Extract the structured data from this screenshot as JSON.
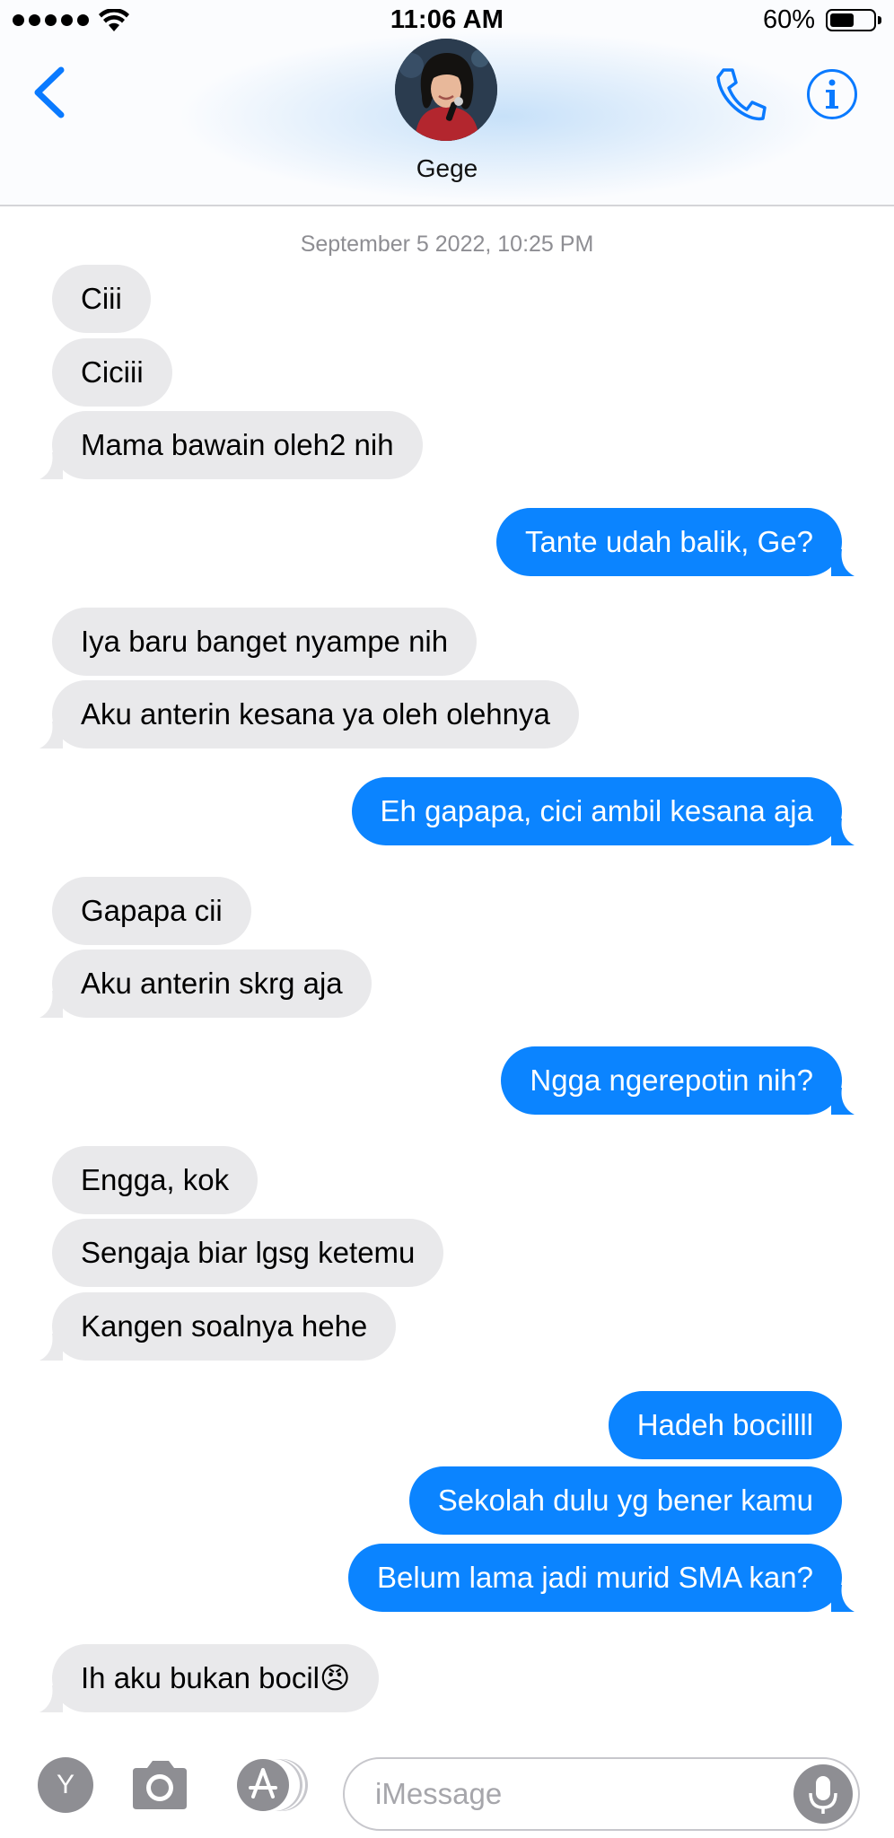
{
  "status_bar": {
    "time": "11:06 AM",
    "battery_percent": "60%",
    "battery_level": 0.6
  },
  "contact": {
    "name": "Gege"
  },
  "conversation": {
    "timestamp": "September 5 2022, 10:25 PM",
    "messages": [
      {
        "from": "them",
        "text": "Ciii"
      },
      {
        "from": "them",
        "text": "Ciciii"
      },
      {
        "from": "them",
        "text": "Mama bawain oleh2 nih"
      },
      {
        "from": "me",
        "text": "Tante udah balik, Ge?"
      },
      {
        "from": "them",
        "text": "Iya baru banget nyampe nih"
      },
      {
        "from": "them",
        "text": "Aku anterin kesana ya oleh olehnya"
      },
      {
        "from": "me",
        "text": "Eh gapapa, cici ambil kesana aja"
      },
      {
        "from": "them",
        "text": "Gapapa cii"
      },
      {
        "from": "them",
        "text": "Aku anterin skrg aja"
      },
      {
        "from": "me",
        "text": "Ngga ngerepotin nih?"
      },
      {
        "from": "them",
        "text": "Engga, kok"
      },
      {
        "from": "them",
        "text": "Sengaja biar lgsg ketemu"
      },
      {
        "from": "them",
        "text": "Kangen soalnya hehe"
      },
      {
        "from": "me",
        "text": "Hadeh bocillll"
      },
      {
        "from": "me",
        "text": "Sekolah dulu yg bener kamu"
      },
      {
        "from": "me",
        "text": "Belum lama jadi murid SMA kan?"
      },
      {
        "from": "them",
        "text": "Ih aku bukan bocil😠"
      }
    ]
  },
  "composer": {
    "y_label": "Y",
    "placeholder": "iMessage"
  },
  "icons": [
    "back-chevron-icon",
    "phone-icon",
    "info-icon",
    "camera-icon",
    "app-store-icon",
    "microphone-icon",
    "wifi-icon"
  ],
  "colors": {
    "sent_bubble": "#0b84ff",
    "received_bubble": "#e9e9eb",
    "accent": "#0a7aff"
  }
}
